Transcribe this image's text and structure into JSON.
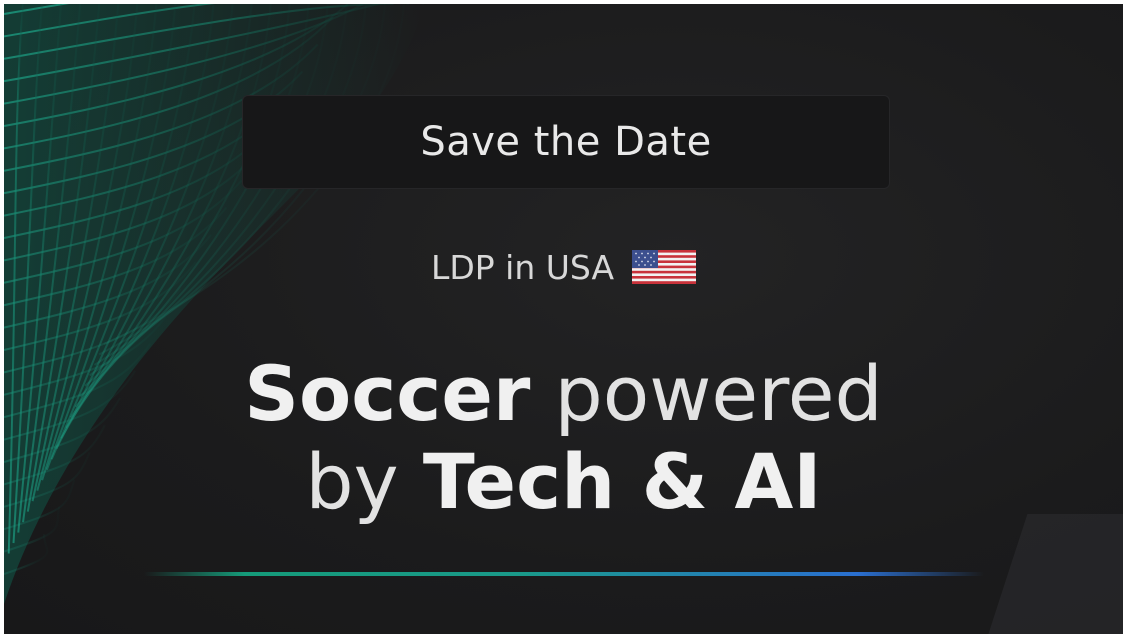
{
  "banner": {
    "save_the_date": "Save the Date",
    "subtitle": "LDP in USA",
    "flag_icon": "us-flag-icon",
    "headline_line1_bold": "Soccer",
    "headline_line1_light": " powered",
    "headline_line2_light": "by ",
    "headline_line2_bold": "Tech & AI"
  },
  "colors": {
    "background": "#1d1d1e",
    "mesh_accent": "#1aa88a",
    "text": "#e9e9e9",
    "underline_start": "#159b7a",
    "underline_end": "#2a6fd0"
  }
}
